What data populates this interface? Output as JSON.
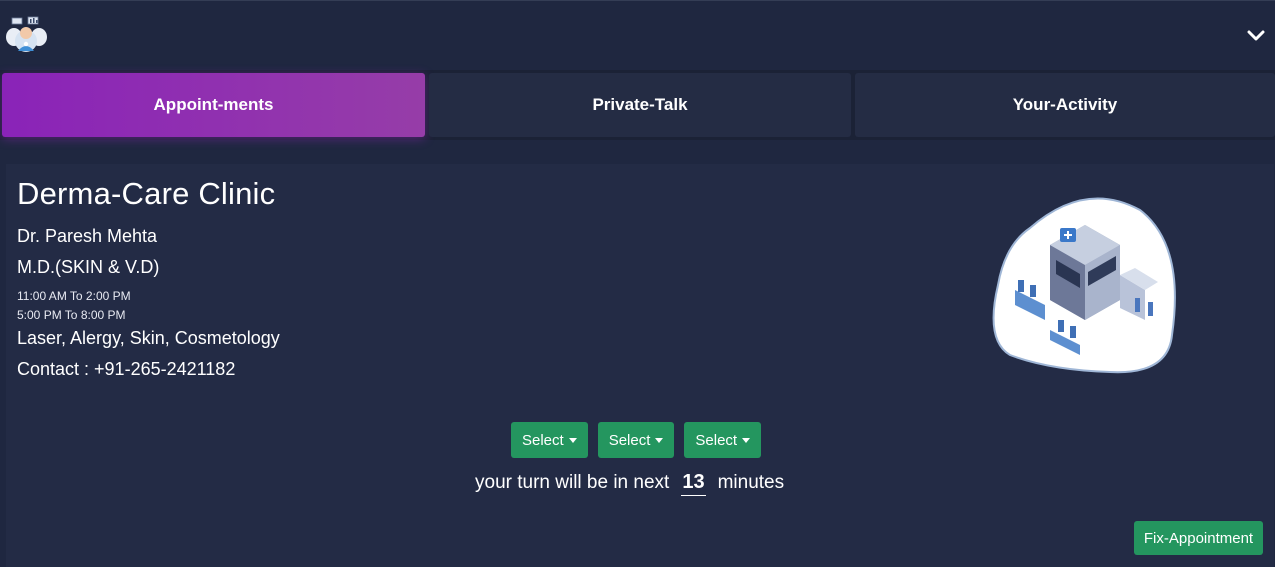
{
  "header": {
    "logo_icon": "doctor-avatar-icon",
    "toggle_icon": "chevron-down-icon"
  },
  "tabs": [
    {
      "label": "Appoint-ments",
      "active": true
    },
    {
      "label": "Private-Talk",
      "active": false
    },
    {
      "label": "Your-Activity",
      "active": false
    }
  ],
  "clinic": {
    "name": "Derma-Care Clinic",
    "doctor": "Dr. Paresh Mehta",
    "qualification": "M.D.(SKIN & V.D)",
    "timings": [
      "11:00 AM To 2:00 PM",
      "5:00 PM To 8:00 PM"
    ],
    "specialities": "Laser, Alergy, Skin, Cosmetology",
    "contact": "Contact : +91-265-2421182",
    "illustration_icon": "hospital-building-icon"
  },
  "appointment": {
    "selects": [
      "Select",
      "Select",
      "Select"
    ],
    "turn_prefix": "your turn will be in next",
    "turn_minutes": "13",
    "turn_suffix": "minutes",
    "fix_button": "Fix-Appointment"
  },
  "colors": {
    "background": "#1f2740",
    "active_tab": "#8a23b8",
    "button_green": "#24965f"
  }
}
